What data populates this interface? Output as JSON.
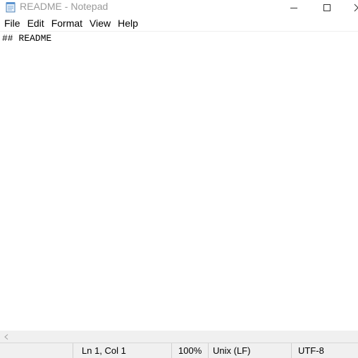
{
  "window": {
    "title": "README - Notepad",
    "icons": {
      "app": "notepad-icon",
      "minimize": "minimize-icon",
      "maximize": "maximize-icon",
      "close": "close-icon"
    }
  },
  "menu": {
    "items": [
      {
        "label": "File"
      },
      {
        "label": "Edit"
      },
      {
        "label": "Format"
      },
      {
        "label": "View"
      },
      {
        "label": "Help"
      }
    ]
  },
  "editor": {
    "content": "## README"
  },
  "scrollbar": {
    "left_icon": "scroll-left-arrow-icon"
  },
  "status": {
    "position": "Ln 1, Col 1",
    "zoom": "100%",
    "line_ending": "Unix (LF)",
    "encoding": "UTF-8"
  },
  "colors": {
    "title_text": "#9a9a9a",
    "chrome_bg": "#f0f0f0",
    "editor_bg": "#ffffff"
  }
}
